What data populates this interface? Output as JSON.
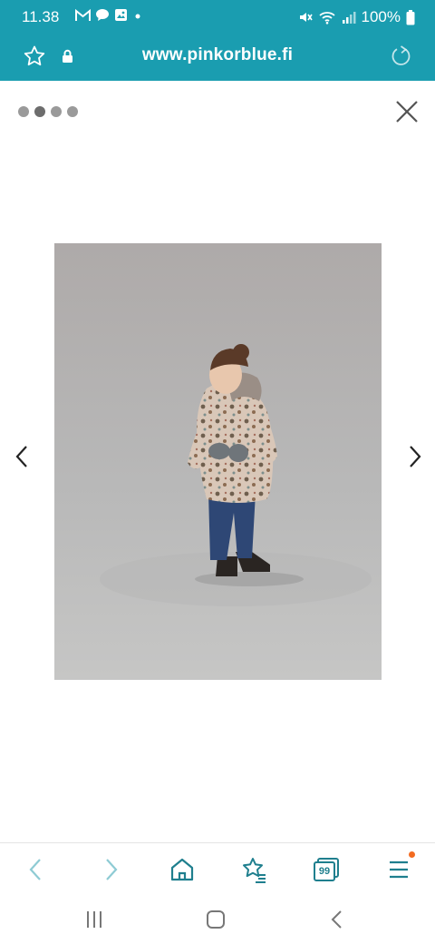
{
  "status_bar": {
    "time": "11.38",
    "battery": "100%",
    "icons": [
      "gmail-icon",
      "chat-icon",
      "gallery-icon",
      "dot-icon",
      "mute-icon",
      "wifi-icon",
      "signal-icon",
      "battery-icon"
    ]
  },
  "url_bar": {
    "url": "www.pinkorblue.fi",
    "icons": [
      "star-outline-icon",
      "lock-icon",
      "reload-icon"
    ]
  },
  "gallery": {
    "dot_count": 4,
    "active_dot": 1,
    "image_alt": "Child in patterned winter jacket and jeans"
  },
  "bottom_bar": {
    "items": [
      "back-icon",
      "forward-icon",
      "home-icon",
      "bookmarks-icon",
      "tabs-icon",
      "menu-icon"
    ],
    "tabs_count": "99"
  },
  "colors": {
    "accent": "#1a9db0",
    "notification": "#f36b21"
  }
}
